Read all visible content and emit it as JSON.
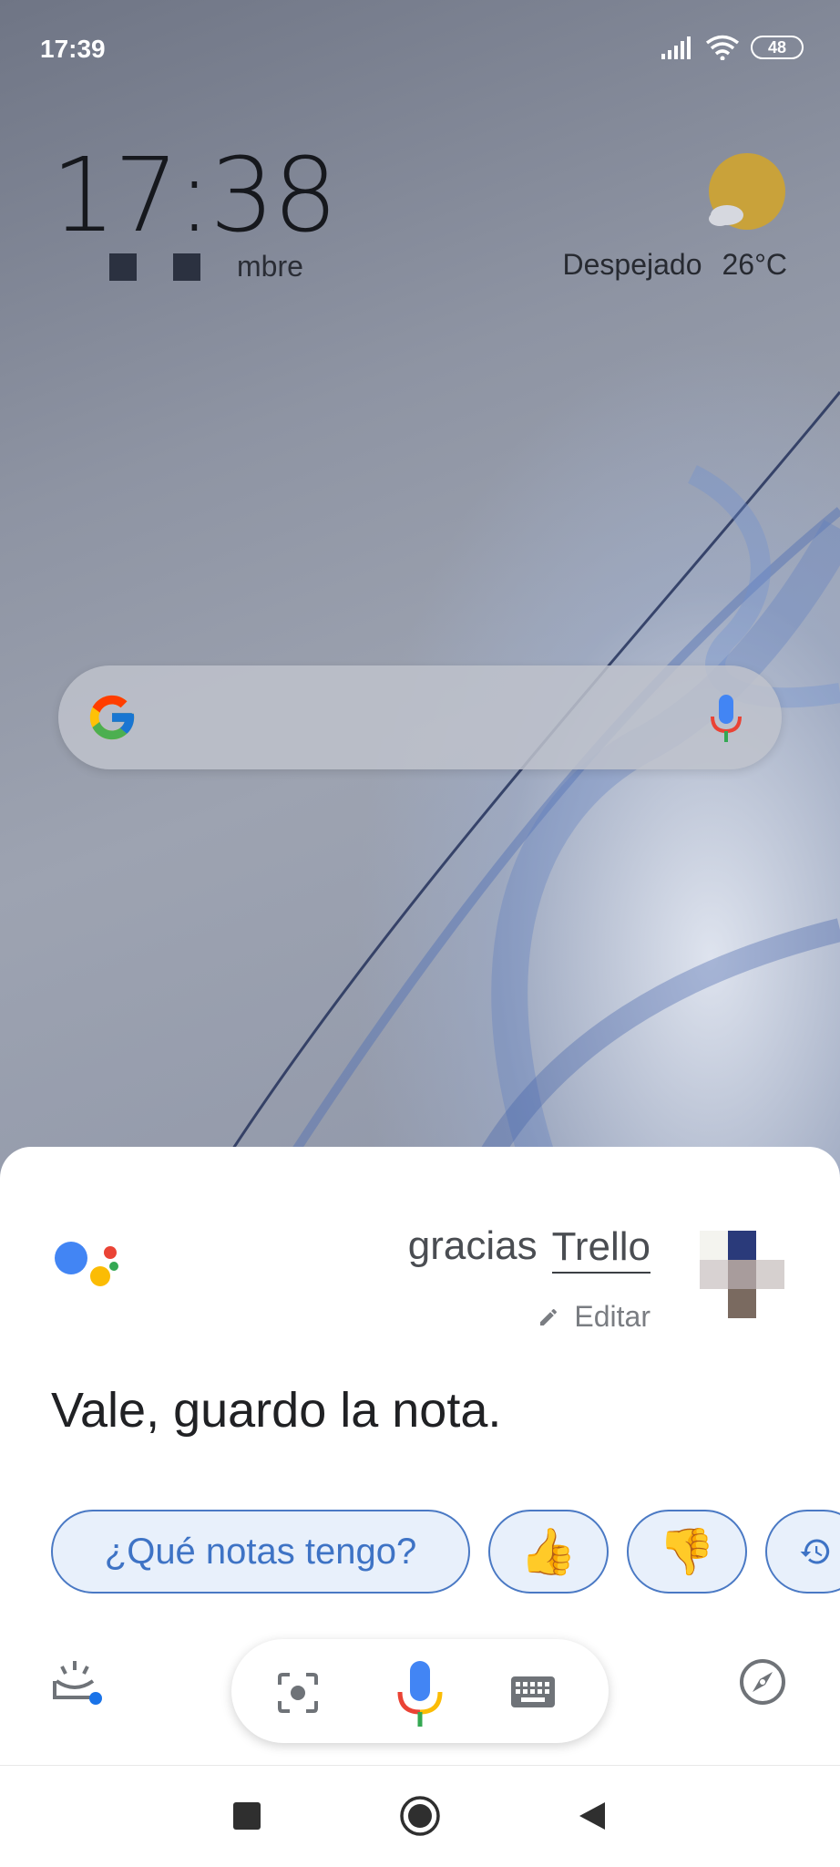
{
  "status_bar": {
    "time": "17:39",
    "battery": "48",
    "icons": [
      "signal-icon",
      "wifi-icon",
      "battery-icon"
    ]
  },
  "home": {
    "clock": "17:38",
    "date_suffix": "mbre",
    "weather_condition": "Despejado",
    "weather_temp": "26°C"
  },
  "assistant": {
    "query_prefix": "gracias",
    "query_app": "Trello",
    "edit_label": "Editar",
    "response": "Vale, guardo la nota.",
    "chips": [
      {
        "label": "¿Qué notas tengo?",
        "type": "text"
      },
      {
        "label": "👍",
        "type": "emoji"
      },
      {
        "label": "👎",
        "type": "emoji"
      }
    ]
  },
  "colors": {
    "accent_blue": "#4285F4",
    "google_red": "#EA4335",
    "google_yellow": "#FBBC05",
    "google_green": "#34A853",
    "chip_text": "#3e73c5"
  }
}
